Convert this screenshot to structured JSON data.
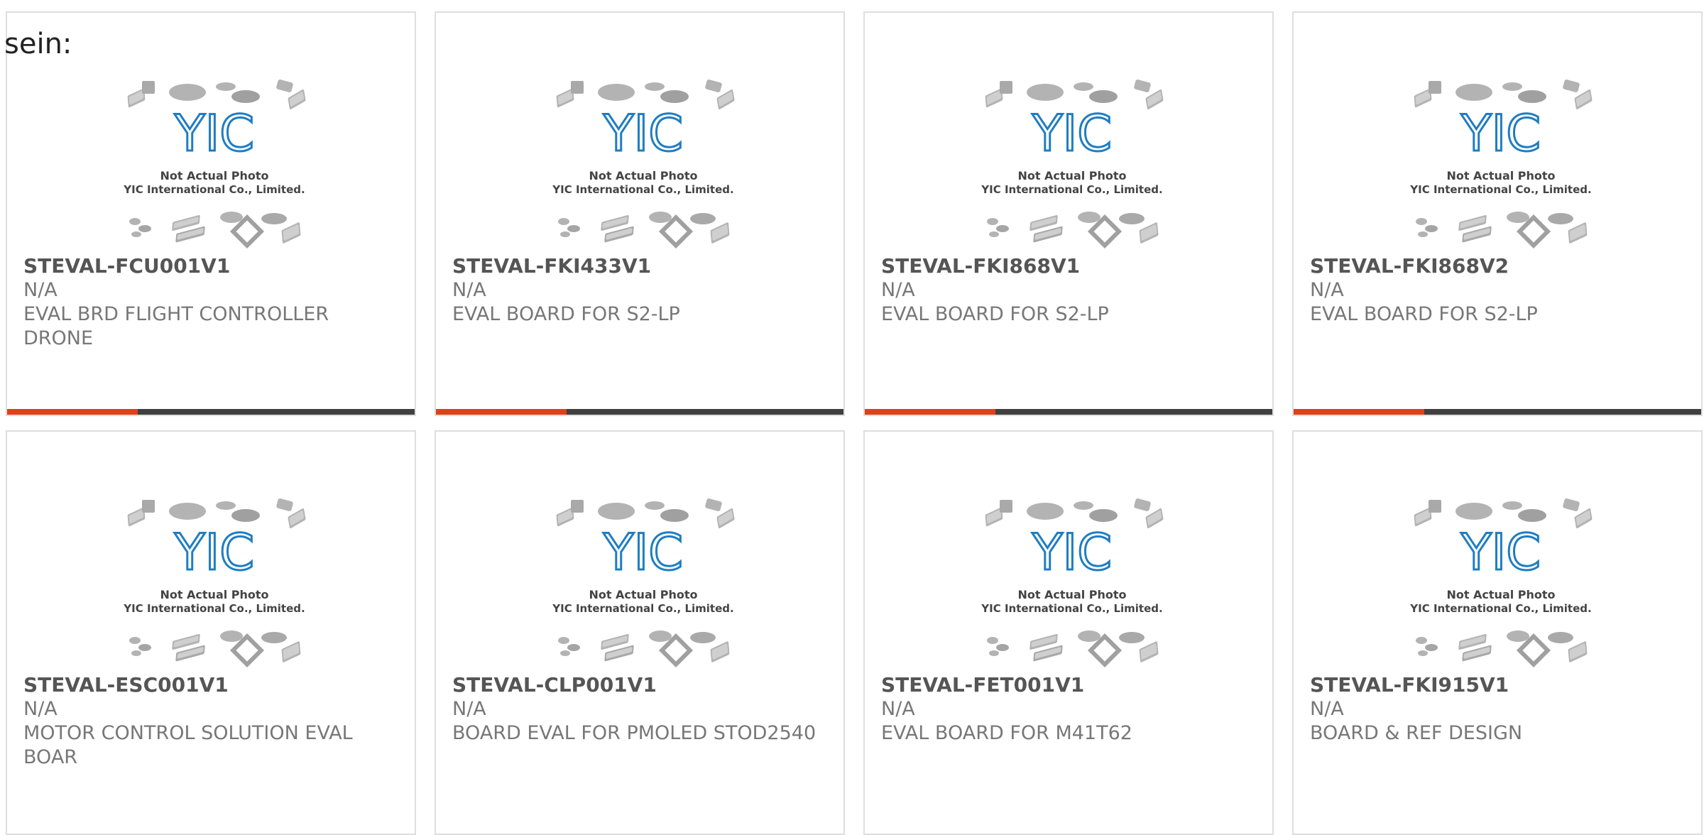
{
  "page_label": "sein:",
  "placeholder_image": {
    "logo_text": "YIC",
    "caption_line1": "Not Actual Photo",
    "caption_line2": "YIC International Co., Limited."
  },
  "colors": {
    "accent": "#e0401c",
    "bar_dark": "#404040",
    "logo_blue": "#1f7dc1",
    "chip_gray": "#b3b3b3"
  },
  "products": [
    {
      "part": "STEVAL-FCU001V1",
      "mfr": "N/A",
      "desc": "EVAL BRD FLIGHT CONTROLLER DRONE"
    },
    {
      "part": "STEVAL-FKI433V1",
      "mfr": "N/A",
      "desc": "EVAL BOARD FOR S2-LP"
    },
    {
      "part": "STEVAL-FKI868V1",
      "mfr": "N/A",
      "desc": "EVAL BOARD FOR S2-LP"
    },
    {
      "part": "STEVAL-FKI868V2",
      "mfr": "N/A",
      "desc": "EVAL BOARD FOR S2-LP"
    },
    {
      "part": "STEVAL-ESC001V1",
      "mfr": "N/A",
      "desc": "MOTOR CONTROL SOLUTION EVAL BOAR"
    },
    {
      "part": "STEVAL-CLP001V1",
      "mfr": "N/A",
      "desc": "BOARD EVAL FOR PMOLED STOD2540"
    },
    {
      "part": "STEVAL-FET001V1",
      "mfr": "N/A",
      "desc": "EVAL BOARD FOR M41T62"
    },
    {
      "part": "STEVAL-FKI915V1",
      "mfr": "N/A",
      "desc": "BOARD & REF DESIGN"
    }
  ]
}
